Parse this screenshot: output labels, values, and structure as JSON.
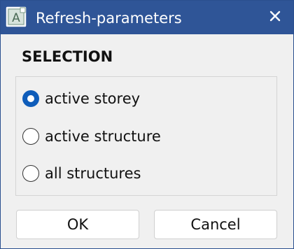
{
  "window": {
    "title": "Refresh-parameters",
    "app_icon_letter": "A",
    "icon": "app-icon",
    "close_icon": "close-icon",
    "titlebar_color": "#2f5597"
  },
  "selection": {
    "heading": "SELECTION",
    "options": [
      {
        "label": "active storey",
        "checked": true
      },
      {
        "label": "active structure",
        "checked": false
      },
      {
        "label": "all structures",
        "checked": false
      }
    ],
    "accent_color": "#0f5dba"
  },
  "buttons": {
    "ok": "OK",
    "cancel": "Cancel"
  }
}
